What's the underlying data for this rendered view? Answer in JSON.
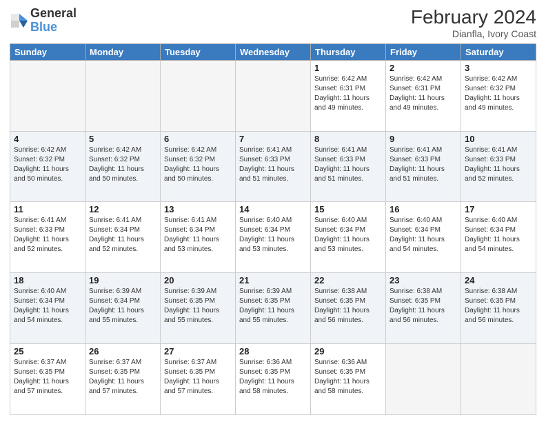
{
  "header": {
    "logo_general": "General",
    "logo_blue": "Blue",
    "month_year": "February 2024",
    "location": "Dianfla, Ivory Coast"
  },
  "weekdays": [
    "Sunday",
    "Monday",
    "Tuesday",
    "Wednesday",
    "Thursday",
    "Friday",
    "Saturday"
  ],
  "weeks": [
    [
      {
        "day": "",
        "info": ""
      },
      {
        "day": "",
        "info": ""
      },
      {
        "day": "",
        "info": ""
      },
      {
        "day": "",
        "info": ""
      },
      {
        "day": "1",
        "info": "Sunrise: 6:42 AM\nSunset: 6:31 PM\nDaylight: 11 hours\nand 49 minutes."
      },
      {
        "day": "2",
        "info": "Sunrise: 6:42 AM\nSunset: 6:31 PM\nDaylight: 11 hours\nand 49 minutes."
      },
      {
        "day": "3",
        "info": "Sunrise: 6:42 AM\nSunset: 6:32 PM\nDaylight: 11 hours\nand 49 minutes."
      }
    ],
    [
      {
        "day": "4",
        "info": "Sunrise: 6:42 AM\nSunset: 6:32 PM\nDaylight: 11 hours\nand 50 minutes."
      },
      {
        "day": "5",
        "info": "Sunrise: 6:42 AM\nSunset: 6:32 PM\nDaylight: 11 hours\nand 50 minutes."
      },
      {
        "day": "6",
        "info": "Sunrise: 6:42 AM\nSunset: 6:32 PM\nDaylight: 11 hours\nand 50 minutes."
      },
      {
        "day": "7",
        "info": "Sunrise: 6:41 AM\nSunset: 6:33 PM\nDaylight: 11 hours\nand 51 minutes."
      },
      {
        "day": "8",
        "info": "Sunrise: 6:41 AM\nSunset: 6:33 PM\nDaylight: 11 hours\nand 51 minutes."
      },
      {
        "day": "9",
        "info": "Sunrise: 6:41 AM\nSunset: 6:33 PM\nDaylight: 11 hours\nand 51 minutes."
      },
      {
        "day": "10",
        "info": "Sunrise: 6:41 AM\nSunset: 6:33 PM\nDaylight: 11 hours\nand 52 minutes."
      }
    ],
    [
      {
        "day": "11",
        "info": "Sunrise: 6:41 AM\nSunset: 6:33 PM\nDaylight: 11 hours\nand 52 minutes."
      },
      {
        "day": "12",
        "info": "Sunrise: 6:41 AM\nSunset: 6:34 PM\nDaylight: 11 hours\nand 52 minutes."
      },
      {
        "day": "13",
        "info": "Sunrise: 6:41 AM\nSunset: 6:34 PM\nDaylight: 11 hours\nand 53 minutes."
      },
      {
        "day": "14",
        "info": "Sunrise: 6:40 AM\nSunset: 6:34 PM\nDaylight: 11 hours\nand 53 minutes."
      },
      {
        "day": "15",
        "info": "Sunrise: 6:40 AM\nSunset: 6:34 PM\nDaylight: 11 hours\nand 53 minutes."
      },
      {
        "day": "16",
        "info": "Sunrise: 6:40 AM\nSunset: 6:34 PM\nDaylight: 11 hours\nand 54 minutes."
      },
      {
        "day": "17",
        "info": "Sunrise: 6:40 AM\nSunset: 6:34 PM\nDaylight: 11 hours\nand 54 minutes."
      }
    ],
    [
      {
        "day": "18",
        "info": "Sunrise: 6:40 AM\nSunset: 6:34 PM\nDaylight: 11 hours\nand 54 minutes."
      },
      {
        "day": "19",
        "info": "Sunrise: 6:39 AM\nSunset: 6:34 PM\nDaylight: 11 hours\nand 55 minutes."
      },
      {
        "day": "20",
        "info": "Sunrise: 6:39 AM\nSunset: 6:35 PM\nDaylight: 11 hours\nand 55 minutes."
      },
      {
        "day": "21",
        "info": "Sunrise: 6:39 AM\nSunset: 6:35 PM\nDaylight: 11 hours\nand 55 minutes."
      },
      {
        "day": "22",
        "info": "Sunrise: 6:38 AM\nSunset: 6:35 PM\nDaylight: 11 hours\nand 56 minutes."
      },
      {
        "day": "23",
        "info": "Sunrise: 6:38 AM\nSunset: 6:35 PM\nDaylight: 11 hours\nand 56 minutes."
      },
      {
        "day": "24",
        "info": "Sunrise: 6:38 AM\nSunset: 6:35 PM\nDaylight: 11 hours\nand 56 minutes."
      }
    ],
    [
      {
        "day": "25",
        "info": "Sunrise: 6:37 AM\nSunset: 6:35 PM\nDaylight: 11 hours\nand 57 minutes."
      },
      {
        "day": "26",
        "info": "Sunrise: 6:37 AM\nSunset: 6:35 PM\nDaylight: 11 hours\nand 57 minutes."
      },
      {
        "day": "27",
        "info": "Sunrise: 6:37 AM\nSunset: 6:35 PM\nDaylight: 11 hours\nand 57 minutes."
      },
      {
        "day": "28",
        "info": "Sunrise: 6:36 AM\nSunset: 6:35 PM\nDaylight: 11 hours\nand 58 minutes."
      },
      {
        "day": "29",
        "info": "Sunrise: 6:36 AM\nSunset: 6:35 PM\nDaylight: 11 hours\nand 58 minutes."
      },
      {
        "day": "",
        "info": ""
      },
      {
        "day": "",
        "info": ""
      }
    ]
  ]
}
